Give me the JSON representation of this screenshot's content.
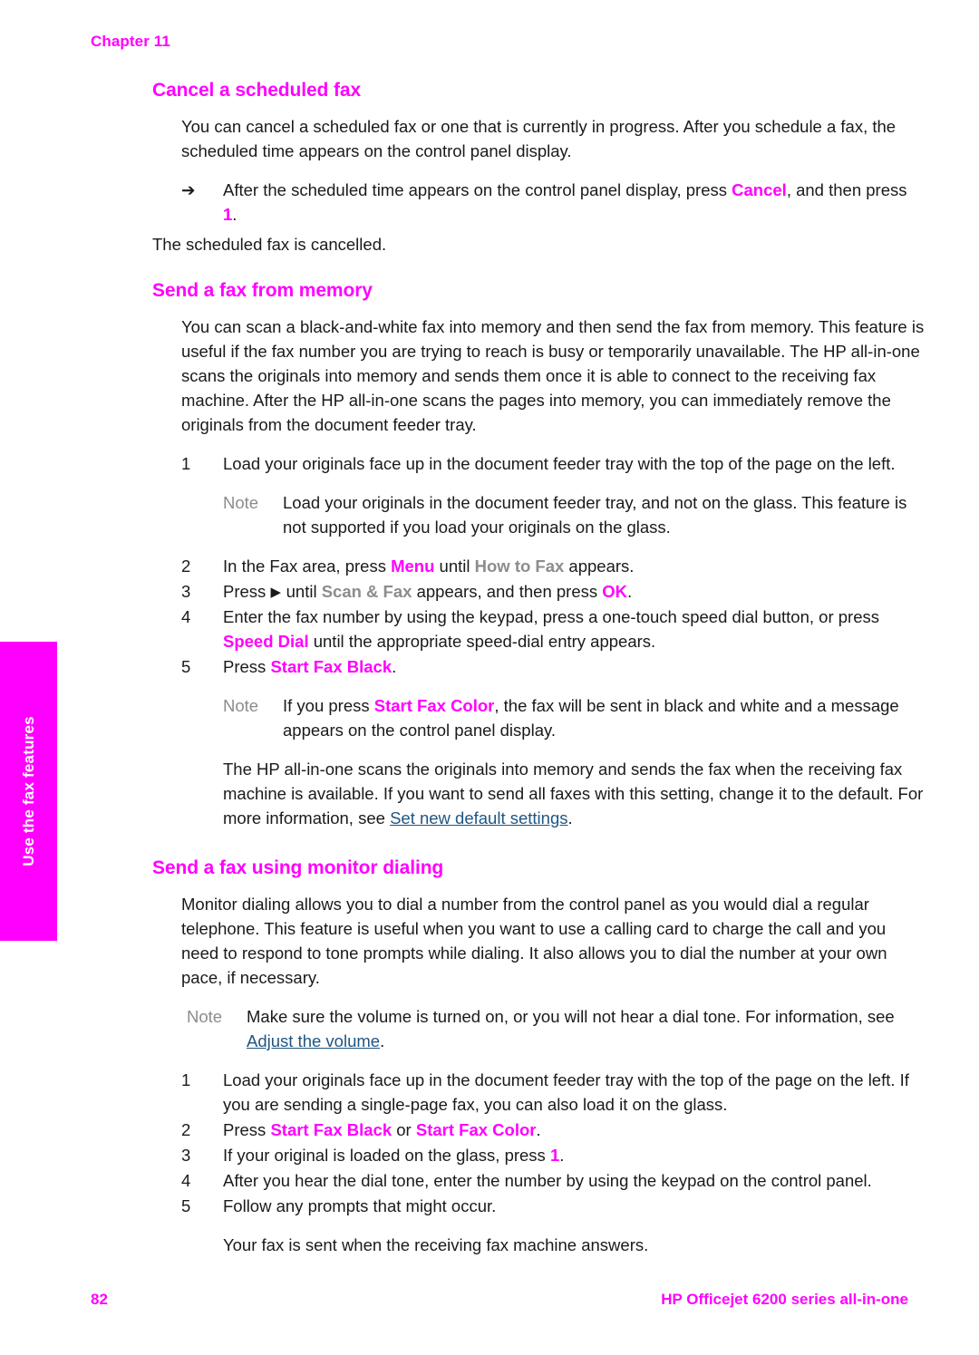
{
  "page": {
    "chapter_label": "Chapter 11",
    "page_number": "82",
    "product_name": "HP Officejet 6200 series all-in-one",
    "side_tab_label": "Use the fax features",
    "accent_color": "#ff00ff",
    "link_color": "#1f5582",
    "display_text_color": "#8c8c8c"
  },
  "sections": [
    {
      "title": "Cancel a scheduled fax",
      "intro": "You can cancel a scheduled fax or one that is currently in progress. After you schedule a fax, the scheduled time appears on the control panel display.",
      "arrow_marker": "➔",
      "arrow_step": {
        "pre": "After the scheduled time appears on the control panel display, press ",
        "button1": "Cancel",
        "mid": ", and then press ",
        "button2": "1",
        "post": "."
      },
      "arrow_follow": "The scheduled fax is cancelled."
    },
    {
      "title": "Send a fax from memory",
      "intro": "You can scan a black-and-white fax into memory and then send the fax from memory. This feature is useful if the fax number you are trying to reach is busy or temporarily unavailable. The HP all-in-one scans the originals into memory and sends them once it is able to connect to the receiving fax machine. After the HP all-in-one scans the pages into memory, you can immediately remove the originals from the document feeder tray.",
      "step1": {
        "num": "1",
        "text": "Load your originals face up in the document feeder tray with the top of the page on the left."
      },
      "note1": {
        "label": "Note",
        "text": "Load your originals in the document feeder tray, and not on the glass. This feature is not supported if you load your originals on the glass."
      },
      "step2": {
        "num": "2",
        "pre": "In the Fax area, press ",
        "button": "Menu",
        "mid": " until ",
        "display": "How to Fax",
        "post": " appears."
      },
      "step3": {
        "num": "3",
        "pre": "Press ",
        "glyph": "▶",
        "mid1": " until ",
        "display": "Scan & Fax",
        "mid2": " appears, and then press ",
        "button": "OK",
        "post": "."
      },
      "step4": {
        "num": "4",
        "pre": "Enter the fax number by using the keypad, press a one-touch speed dial button, or press ",
        "button": "Speed Dial",
        "post": " until the appropriate speed-dial entry appears."
      },
      "step5": {
        "num": "5",
        "pre": "Press ",
        "button": "Start Fax Black",
        "post": "."
      },
      "note2": {
        "label": "Note",
        "pre": "If you press ",
        "button": "Start Fax Color",
        "post": ", the fax will be sent in black and white and a message appears on the control panel display."
      },
      "closing": {
        "pre": "The HP all-in-one scans the originals into memory and sends the fax when the receiving fax machine is available. If you want to send all faxes with this setting, change it to the default. For more information, see ",
        "link": "Set new default settings",
        "post": "."
      }
    },
    {
      "title": "Send a fax using monitor dialing",
      "intro": "Monitor dialing allows you to dial a number from the control panel as you would dial a regular telephone. This feature is useful when you want to use a calling card to charge the call and you need to respond to tone prompts while dialing. It also allows you to dial the number at your own pace, if necessary.",
      "note": {
        "label": "Note",
        "pre": "Make sure the volume is turned on, or you will not hear a dial tone. For information, see ",
        "link": "Adjust the volume",
        "post": "."
      },
      "step1": {
        "num": "1",
        "text": "Load your originals face up in the document feeder tray with the top of the page on the left. If you are sending a single-page fax, you can also load it on the glass."
      },
      "step2": {
        "num": "2",
        "pre": "Press ",
        "button1": "Start Fax Black",
        "mid": " or ",
        "button2": "Start Fax Color",
        "post": "."
      },
      "step3": {
        "num": "3",
        "pre": "If your original is loaded on the glass, press ",
        "button": "1",
        "post": "."
      },
      "step4": {
        "num": "4",
        "text": "After you hear the dial tone, enter the number by using the keypad on the control panel."
      },
      "step5": {
        "num": "5",
        "text": "Follow any prompts that might occur."
      },
      "closing": "Your fax is sent when the receiving fax machine answers."
    }
  ]
}
